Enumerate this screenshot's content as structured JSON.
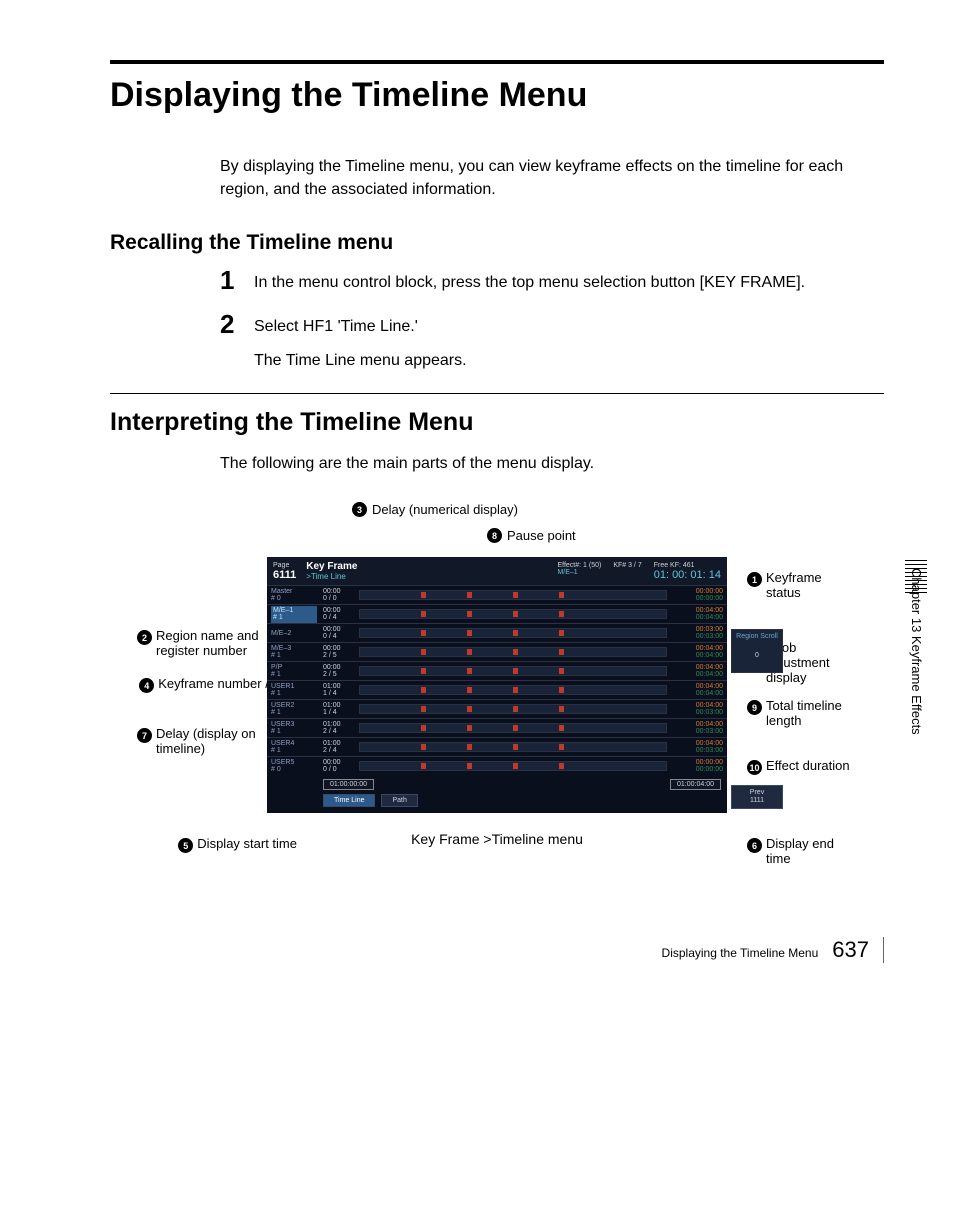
{
  "title": "Displaying the Timeline Menu",
  "intro": "By displaying the Timeline menu, you can view keyframe effects on the timeline for each region, and the associated information.",
  "h_recall": "Recalling the Timeline menu",
  "step1": "In the menu control block, press the top menu selection button [KEY FRAME].",
  "step2": "Select HF1 'Time Line.'",
  "step2_sub": "The Time Line menu appears.",
  "h_interpret": "Interpreting the Timeline Menu",
  "interpret_intro": "The following are the main parts of the menu display.",
  "topc3": "Delay (numerical display)",
  "topc8": "Pause point",
  "c1": "Keyframe status",
  "c2": "Region name and register number",
  "c4": "Keyframe number / total",
  "c5": "Display start time",
  "c6": "Display end time",
  "c7": "Delay (display on timeline)",
  "c9": "Total timeline length",
  "c10": "Effect duration",
  "c11": "Knob adjustment display",
  "caption": "Key Frame >Timeline menu",
  "side": "Chapter 13  Keyframe Effects",
  "footer_title": "Displaying the Timeline Menu",
  "page_no": "637",
  "screen": {
    "page_label": "Page",
    "page_num": "6111",
    "title": "Key Frame",
    "sub": ">Time Line",
    "effect": "Effect#: 1 (50)",
    "me": "M/E–1",
    "free": "Free KF: 461",
    "kf": "KF# 3 / 7",
    "tc": "01: 00: 01: 14",
    "knob_l1": "Region Scroll",
    "knob_l2": "0",
    "start_tc": "01:00:00:00",
    "end_tc": "01:00:04:00",
    "btn_tl": "Time Line",
    "btn_path": "Path",
    "prev": "Prev",
    "prev_n": "1111",
    "rows": [
      {
        "name": "Master",
        "sub": "# 0",
        "kf": "00:00\n0 / 0",
        "t1": "00:00:00",
        "t2": "00:00:00"
      },
      {
        "name": "M/E–1",
        "sub": "# 1",
        "kf": "00:00\n0 / 4",
        "t1": "00:04:00",
        "t2": "00:04:00",
        "hl": true
      },
      {
        "name": "M/E–2",
        "sub": "",
        "kf": "00:00\n0 / 4",
        "t1": "00:03:00",
        "t2": "00:03:00"
      },
      {
        "name": "M/E–3",
        "sub": "# 1",
        "kf": "00:00\n2 / 5",
        "t1": "00:04:00",
        "t2": "00:04:00"
      },
      {
        "name": "P/P",
        "sub": "# 1",
        "kf": "00:00\n2 / 5",
        "t1": "00:04:00",
        "t2": "00:04:00"
      },
      {
        "name": "USER1",
        "sub": "# 1",
        "kf": "01:00\n1 / 4",
        "t1": "00:04:00",
        "t2": "00:04:00"
      },
      {
        "name": "USER2",
        "sub": "# 1",
        "kf": "01:00\n1 / 4",
        "t1": "00:04:00",
        "t2": "00:03:00"
      },
      {
        "name": "USER3",
        "sub": "# 1",
        "kf": "01:00\n2 / 4",
        "t1": "00:04:00",
        "t2": "00:03:00"
      },
      {
        "name": "USER4",
        "sub": "# 1",
        "kf": "01:00\n2 / 4",
        "t1": "00:04:00",
        "t2": "00:03:00"
      },
      {
        "name": "USER5",
        "sub": "# 0",
        "kf": "00:00\n0 / 0",
        "t1": "00:00:00",
        "t2": "00:00:00"
      }
    ]
  }
}
